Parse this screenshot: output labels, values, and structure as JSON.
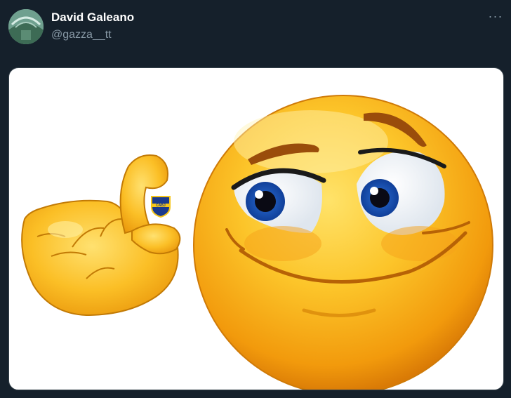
{
  "tweet": {
    "author": {
      "display_name": "David Galeano",
      "handle": "@gazza__tt"
    },
    "more_icon": "more-horizontal-icon",
    "more_label": "···",
    "media": {
      "subject": "pinching-hand-emoji-and-smirking-face-emoji",
      "badge_text": "CABJ"
    }
  },
  "colors": {
    "background": "#15202b",
    "name_text": "#ffffff",
    "handle_text": "#8899a6",
    "emoji_yellow": "#f8b417",
    "badge_blue": "#1b3a8c",
    "badge_gold": "#f5c518"
  }
}
